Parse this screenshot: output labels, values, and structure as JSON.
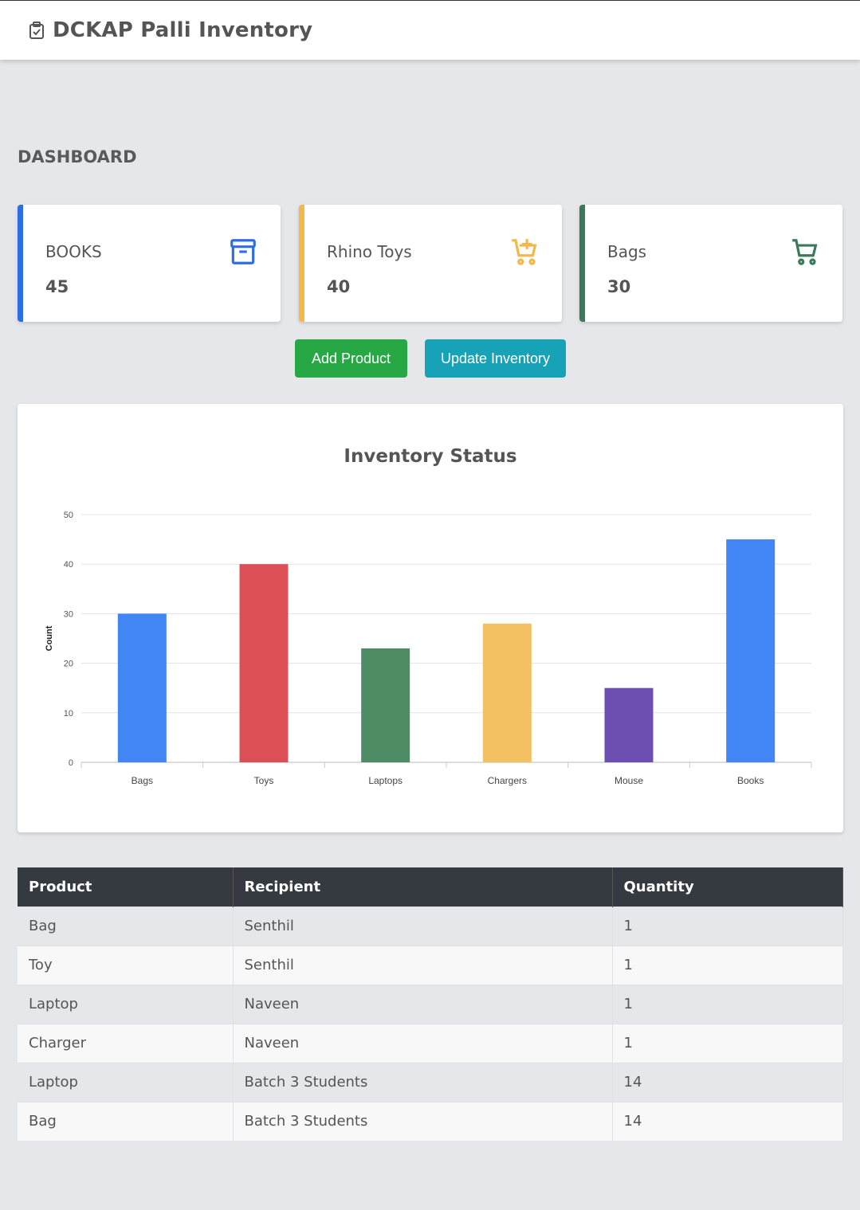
{
  "app": {
    "title": "DCKAP Palli Inventory",
    "icon": "clipboard-check-icon"
  },
  "page": {
    "title": "DASHBOARD"
  },
  "cards": [
    {
      "label": "BOOKS",
      "value": "45",
      "color": "#2d6fe0",
      "icon": "archive-box-icon"
    },
    {
      "label": "Rhino Toys",
      "value": "40",
      "color": "#f2b94a",
      "icon": "cart-plus-icon"
    },
    {
      "label": "Bags",
      "value": "30",
      "color": "#3a7a58",
      "icon": "cart-icon"
    }
  ],
  "buttons": {
    "add_product": {
      "label": "Add Product",
      "color": "#28a745"
    },
    "update_inventory": {
      "label": "Update Inventory",
      "color": "#17a2b8"
    }
  },
  "chart_data": {
    "type": "bar",
    "title": "Inventory Status",
    "xlabel": "",
    "ylabel": "Count",
    "categories": [
      "Bags",
      "Toys",
      "Laptops",
      "Chargers",
      "Mouse",
      "Books"
    ],
    "values": [
      30,
      40,
      23,
      28,
      15,
      45
    ],
    "colors": [
      "#4285f4",
      "#db4f55",
      "#4e8c66",
      "#f4c162",
      "#6c4fb0",
      "#4285f4"
    ],
    "ylim": [
      0,
      50
    ],
    "yticks": [
      0,
      10,
      20,
      30,
      40,
      50
    ],
    "grid": true,
    "legend": "none"
  },
  "table": {
    "columns": [
      "Product",
      "Recipient",
      "Quantity"
    ],
    "rows": [
      [
        "Bag",
        "Senthil",
        "1"
      ],
      [
        "Toy",
        "Senthil",
        "1"
      ],
      [
        "Laptop",
        "Naveen",
        "1"
      ],
      [
        "Charger",
        "Naveen",
        "1"
      ],
      [
        "Laptop",
        "Batch 3 Students",
        "14"
      ],
      [
        "Bag",
        "Batch 3 Students",
        "14"
      ]
    ]
  }
}
